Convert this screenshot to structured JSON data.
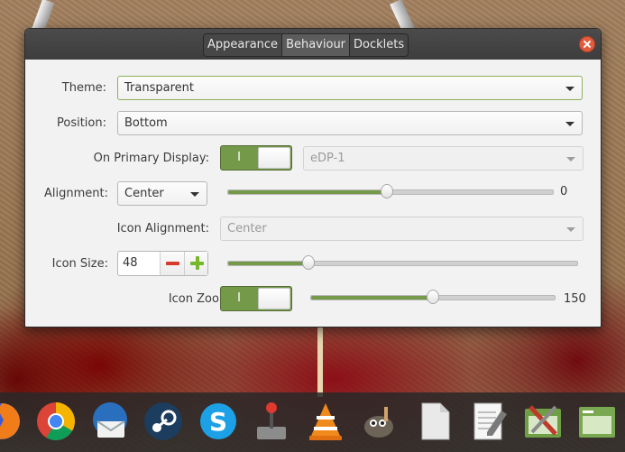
{
  "window": {
    "tabs": [
      {
        "label": "Appearance",
        "active": false
      },
      {
        "label": "Behaviour",
        "active": true
      },
      {
        "label": "Docklets",
        "active": false
      }
    ]
  },
  "settings": {
    "theme": {
      "label": "Theme:",
      "value": "Transparent"
    },
    "position": {
      "label": "Position:",
      "value": "Bottom"
    },
    "primary_display": {
      "label": "On Primary Display:",
      "switch_text": "I",
      "on": true,
      "monitor": "eDP-1"
    },
    "alignment": {
      "label": "Alignment:",
      "value": "Center",
      "offset_value": "0",
      "offset_fraction": 0.49
    },
    "icon_alignment": {
      "label": "Icon Alignment:",
      "value": "Center"
    },
    "icon_size": {
      "label": "Icon Size:",
      "value": "48",
      "slider_fraction": 0.23
    },
    "icon_zoom": {
      "label": "Icon Zoom:",
      "switch_text": "I",
      "on": true,
      "value": "150",
      "slider_fraction": 0.5
    }
  },
  "colors": {
    "accent": "#749a49",
    "close": "#e25b3c",
    "titlebar": "#3d3d3d"
  },
  "dock": {
    "apps": [
      "firefox-icon",
      "chrome-icon",
      "thunderbird-icon",
      "steam-icon",
      "skype-icon",
      "joystick-icon",
      "vlc-icon",
      "gimp-icon",
      "file-icon",
      "text-editor-icon",
      "system-settings-icon",
      "window-icon"
    ]
  }
}
